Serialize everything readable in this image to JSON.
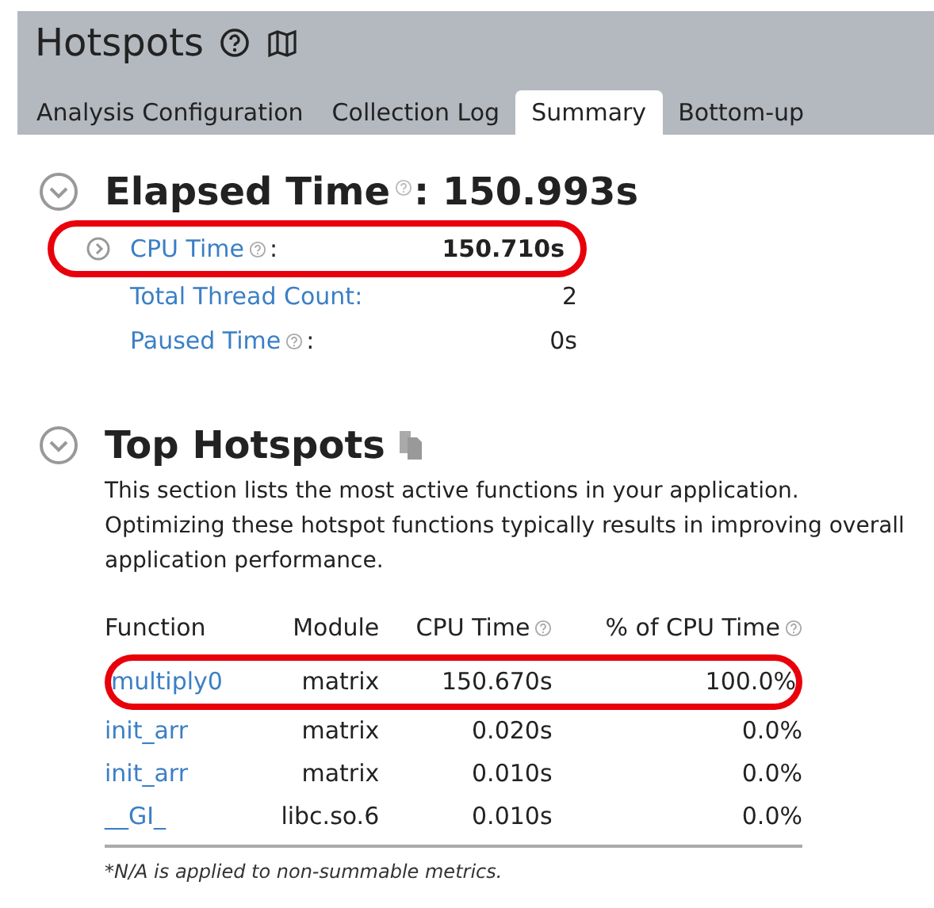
{
  "header": {
    "title": "Hotspots"
  },
  "tabs": [
    {
      "label": "Analysis Configuration",
      "selected": false
    },
    {
      "label": "Collection Log",
      "selected": false
    },
    {
      "label": "Summary",
      "selected": true
    },
    {
      "label": "Bottom-up",
      "selected": false
    }
  ],
  "elapsed": {
    "label": "Elapsed Time",
    "value": ": 150.993s",
    "expanded": true
  },
  "metrics": [
    {
      "label": "CPU Time",
      "help": true,
      "colon": ":",
      "value": "150.710s",
      "expandable": true,
      "highlighted": true
    },
    {
      "label": "Total Thread Count:",
      "help": false,
      "value": "2",
      "expandable": false,
      "highlighted": false
    },
    {
      "label": "Paused Time",
      "help": true,
      "colon": ":",
      "value": "0s",
      "expandable": false,
      "highlighted": false
    }
  ],
  "top_hotspots": {
    "title": "Top Hotspots",
    "expanded": true,
    "description": "This section lists the most active functions in your application. Optimizing these hotspot functions typically results in improving overall application performance."
  },
  "table": {
    "columns": [
      {
        "label": "Function",
        "help": false
      },
      {
        "label": "Module",
        "help": false
      },
      {
        "label": "CPU Time",
        "help": true
      },
      {
        "label": "% of CPU Time",
        "help": true
      }
    ],
    "rows": [
      {
        "function": "multiply0",
        "module": "matrix",
        "cpu_time": "150.670s",
        "percent": "100.0%",
        "highlighted": true
      },
      {
        "function": "init_arr",
        "module": "matrix",
        "cpu_time": "0.020s",
        "percent": "0.0%",
        "highlighted": false
      },
      {
        "function": "init_arr",
        "module": "matrix",
        "cpu_time": "0.010s",
        "percent": "0.0%",
        "highlighted": false
      },
      {
        "function": "__GI_",
        "module": "libc.so.6",
        "cpu_time": "0.010s",
        "percent": "0.0%",
        "highlighted": false
      }
    ]
  },
  "footnote": "*N/A is applied to non-summable metrics."
}
